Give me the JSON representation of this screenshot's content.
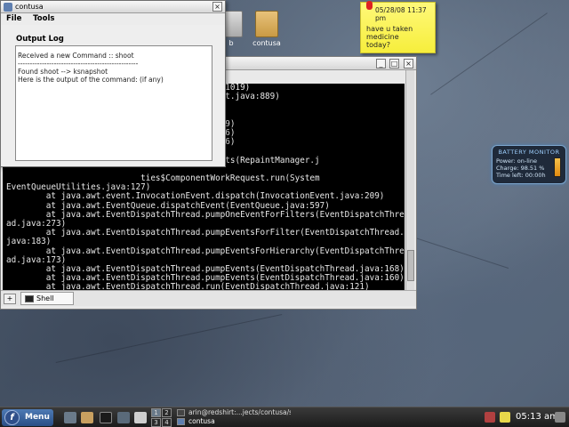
{
  "desktop": {
    "icons": [
      {
        "label": "b"
      },
      {
        "label": "contusa"
      }
    ]
  },
  "sticky_note": {
    "date": "05/28/08 11:37 pm",
    "text_line1": "have u taken medicine",
    "text_line2": "today?"
  },
  "battery_monitor": {
    "title": "BATTERY MONITOR",
    "power": "Power: on-line",
    "charge": "Charge: 98.51 %",
    "time_left": "Time left: 00:00h"
  },
  "terminal": {
    "lines": [
      "                           GroupLayout.java:1019)",
      "                           tainer(GroupLayout.java:889)",
      "                           er.java:1432)",
      "                           iner.java:1421)",
      "                           ontainer.java:1519)",
      "                           ontainer.java:1526)",
      "                           ontainer.java:1526)",
      "                           iner.java:1491)",
      "                           teInvalidComponents(RepaintManager.j",
      "                           ",
      "                           ties$ComponentWorkRequest.run(System",
      "EventQueueUtilities.java:127)",
      "        at java.awt.event.InvocationEvent.dispatch(InvocationEvent.java:209)",
      "        at java.awt.EventQueue.dispatchEvent(EventQueue.java:597)",
      "        at java.awt.EventDispatchThread.pumpOneEventForFilters(EventDispatchThre",
      "ad.java:273)",
      "        at java.awt.EventDispatchThread.pumpEventsForFilter(EventDispatchThread.",
      "java:183)",
      "        at java.awt.EventDispatchThread.pumpEventsForHierarchy(EventDispatchThre",
      "ad.java:173)",
      "        at java.awt.EventDispatchThread.pumpEvents(EventDispatchThread.java:168)",
      "        at java.awt.EventDispatchThread.pumpEvents(EventDispatchThread.java:160)",
      "        at java.awt.EventDispatchThread.run(EventDispatchThread.java:121)",
      "▯"
    ],
    "tab_label": "Shell"
  },
  "app_window": {
    "title": "contusa",
    "menu": {
      "file": "File",
      "tools": "Tools"
    },
    "section_title": "Output Log",
    "log": "Received a new Command :: shoot\n--------------------------------------------------\nFound shoot --> ksnapshot\nHere is the output of the command: (if any)"
  },
  "taskbar": {
    "menu_label": "Menu",
    "pager": [
      "1",
      "2",
      "3",
      "4"
    ],
    "tasks": [
      {
        "label": "arin@redshirt:...jects/contusa/s"
      },
      {
        "label": "contusa"
      }
    ],
    "clock": "05:13 am"
  }
}
